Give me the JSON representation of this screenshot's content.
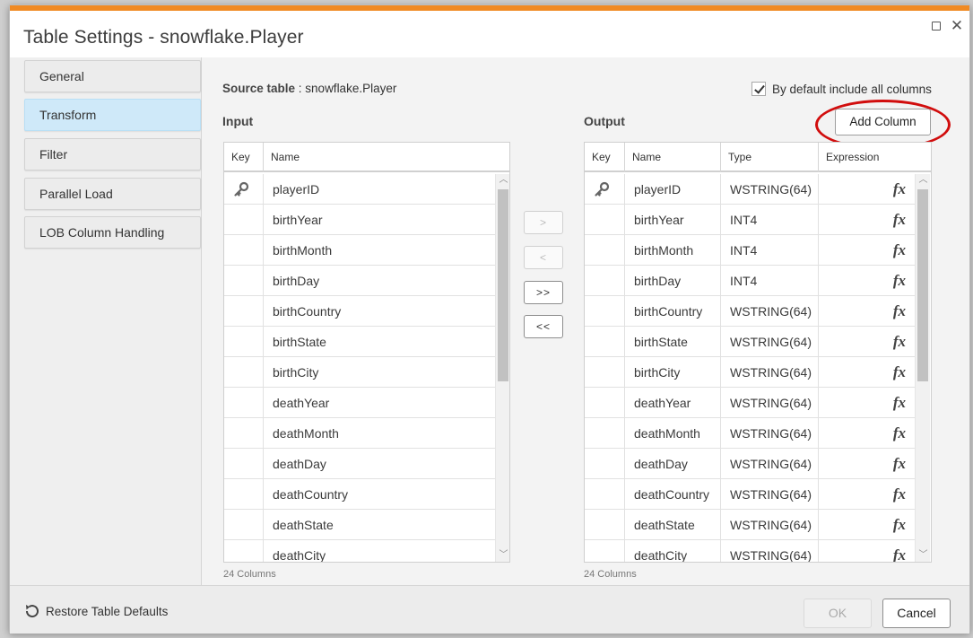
{
  "dialog": {
    "title": "Table Settings - snowflake.Player",
    "accent_color": "#f08a24",
    "maximize_icon": "maximize-icon",
    "close_glyph": "✕"
  },
  "sidebar": {
    "items": [
      {
        "label": "General",
        "active": false
      },
      {
        "label": "Transform",
        "active": true
      },
      {
        "label": "Filter",
        "active": false
      },
      {
        "label": "Parallel Load",
        "active": false
      },
      {
        "label": "LOB Column Handling",
        "active": false
      }
    ]
  },
  "source": {
    "label": "Source table",
    "separator": " : ",
    "value": "snowflake.Player"
  },
  "default_include": {
    "checked": true,
    "label": "By default include all columns"
  },
  "input": {
    "section_label": "Input",
    "headers": [
      "Key",
      "Name"
    ],
    "rows": [
      {
        "key": true,
        "name": "playerID"
      },
      {
        "key": false,
        "name": "birthYear"
      },
      {
        "key": false,
        "name": "birthMonth"
      },
      {
        "key": false,
        "name": "birthDay"
      },
      {
        "key": false,
        "name": "birthCountry"
      },
      {
        "key": false,
        "name": "birthState"
      },
      {
        "key": false,
        "name": "birthCity"
      },
      {
        "key": false,
        "name": "deathYear"
      },
      {
        "key": false,
        "name": "deathMonth"
      },
      {
        "key": false,
        "name": "deathDay"
      },
      {
        "key": false,
        "name": "deathCountry"
      },
      {
        "key": false,
        "name": "deathState"
      },
      {
        "key": false,
        "name": "deathCity"
      }
    ],
    "count_label": "24 Columns"
  },
  "move_buttons": {
    "move_right": ">",
    "move_left": "<",
    "move_all_right": ">>",
    "move_all_left": "<<"
  },
  "output": {
    "section_label": "Output",
    "add_column_label": "Add Column",
    "headers": [
      "Key",
      "Name",
      "Type",
      "Expression"
    ],
    "expression_glyph": "fx",
    "rows": [
      {
        "key": true,
        "name": "playerID",
        "type": "WSTRING(64)"
      },
      {
        "key": false,
        "name": "birthYear",
        "type": "INT4"
      },
      {
        "key": false,
        "name": "birthMonth",
        "type": "INT4"
      },
      {
        "key": false,
        "name": "birthDay",
        "type": "INT4"
      },
      {
        "key": false,
        "name": "birthCountry",
        "type": "WSTRING(64)"
      },
      {
        "key": false,
        "name": "birthState",
        "type": "WSTRING(64)"
      },
      {
        "key": false,
        "name": "birthCity",
        "type": "WSTRING(64)"
      },
      {
        "key": false,
        "name": "deathYear",
        "type": "WSTRING(64)"
      },
      {
        "key": false,
        "name": "deathMonth",
        "type": "WSTRING(64)"
      },
      {
        "key": false,
        "name": "deathDay",
        "type": "WSTRING(64)"
      },
      {
        "key": false,
        "name": "deathCountry",
        "type": "WSTRING(64)"
      },
      {
        "key": false,
        "name": "deathState",
        "type": "WSTRING(64)"
      },
      {
        "key": false,
        "name": "deathCity",
        "type": "WSTRING(64)"
      }
    ],
    "count_label": "24 Columns"
  },
  "annotation": {
    "highlight_color": "#d10d0d"
  },
  "footer": {
    "restore_label": "Restore Table Defaults",
    "restore_icon": "restore-icon",
    "ok_label": "OK",
    "ok_enabled": false,
    "cancel_label": "Cancel"
  }
}
